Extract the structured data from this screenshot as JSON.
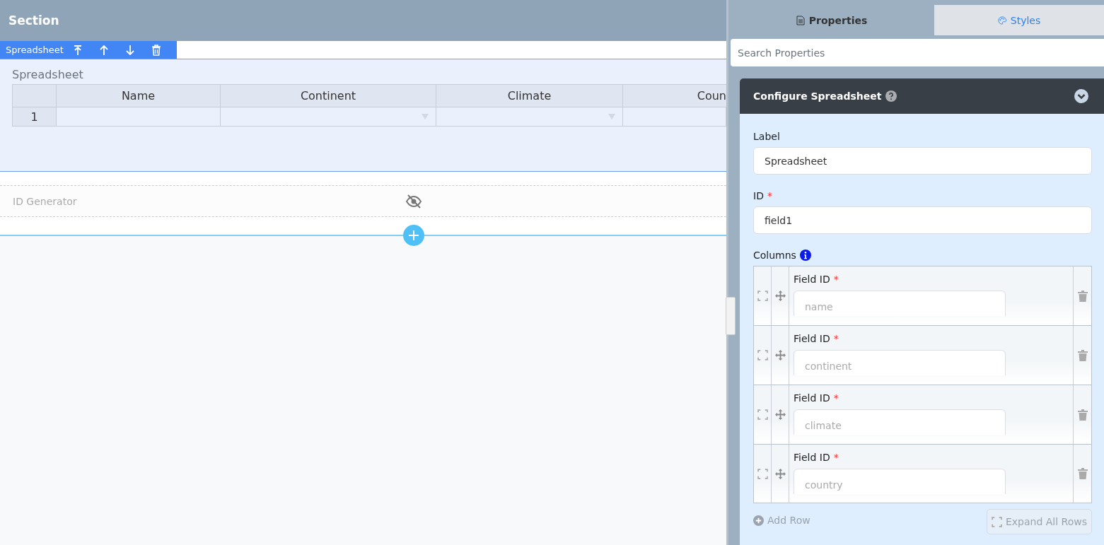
{
  "section": {
    "title": "Section"
  },
  "toolbar": {
    "label": "Spreadsheet"
  },
  "spreadsheet": {
    "label": "Spreadsheet",
    "columns": [
      {
        "header": "Name",
        "dropdown": false
      },
      {
        "header": "Continent",
        "dropdown": true
      },
      {
        "header": "Climate",
        "dropdown": true
      },
      {
        "header": "Coun",
        "dropdown": false
      }
    ],
    "rows": [
      {
        "number": "1"
      }
    ]
  },
  "hidden_field": {
    "label": "ID Generator",
    "hidden": true
  },
  "tabs": [
    {
      "label": "Properties",
      "selected": true,
      "kind": "document"
    },
    {
      "label": "Styles",
      "selected": false,
      "kind": "palette"
    }
  ],
  "search": {
    "placeholder": "Search Properties"
  },
  "panel": {
    "title": "Configure Spreadsheet",
    "expanded": true,
    "fields": [
      {
        "label": "Label",
        "value": "Spreadsheet"
      },
      {
        "label": "ID",
        "required_mark": "*",
        "value": "field1"
      }
    ],
    "columns_label": "Columns",
    "column_rows": [
      {
        "label": "Field ID",
        "required_mark": "*",
        "placeholder": "name"
      },
      {
        "label": "Field ID",
        "required_mark": "*",
        "placeholder": "continent"
      },
      {
        "label": "Field ID",
        "required_mark": "*",
        "placeholder": "climate"
      },
      {
        "label": "Field ID",
        "required_mark": "*",
        "placeholder": "country"
      }
    ],
    "add_row": "Add Row",
    "expand_all": "Expand All Rows"
  }
}
